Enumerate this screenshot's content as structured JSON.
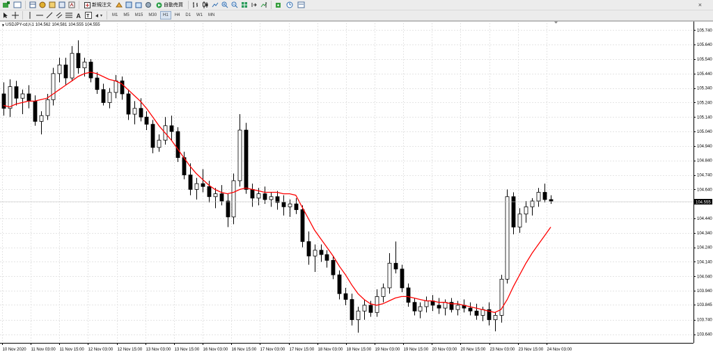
{
  "toolbar": {
    "new_order_label": "新規注文",
    "autotrade_label": "自動売買",
    "timeframes": [
      "M1",
      "M5",
      "M15",
      "M30",
      "H1",
      "H4",
      "D1",
      "W1",
      "MN"
    ],
    "active_timeframe": "H1"
  },
  "chart_header": {
    "symbol": "USDJPY-cd,H1",
    "open": "104.562",
    "high": "104.581",
    "low": "104.555",
    "close": "104.555"
  },
  "colors": {
    "moving_average": "#ff0000",
    "candle_outline": "#000000",
    "bull_candle_fill": "#ffffff",
    "bear_candle_fill": "#000000",
    "grid": "#e4e4e4",
    "price_label_bg": "#000000"
  },
  "chart_data": {
    "type": "candlestick",
    "title": "USDJPY-cd,H1",
    "ylim": [
      103.58,
      105.79
    ],
    "y_ticks": [
      103.64,
      103.74,
      103.845,
      103.94,
      104.04,
      104.14,
      104.24,
      104.34,
      104.44,
      104.555,
      104.64,
      104.74,
      104.84,
      104.94,
      105.04,
      105.14,
      105.24,
      105.34,
      105.44,
      105.54,
      105.64,
      105.74
    ],
    "y_tick_labels": [
      "103.640",
      "103.740",
      "103.845",
      "103.940",
      "104.040",
      "104.140",
      "104.240",
      "104.340",
      "104.440",
      "104.555",
      "104.640",
      "104.740",
      "104.840",
      "104.940",
      "105.040",
      "105.140",
      "105.240",
      "105.340",
      "105.440",
      "105.540",
      "105.640",
      "105.740"
    ],
    "current_price": "104.555",
    "x_labels": [
      "10 Nov 2020",
      "11 Nov 03:00",
      "11 Nov 15:00",
      "12 Nov 03:00",
      "12 Nov 15:00",
      "13 Nov 03:00",
      "13 Nov 15:00",
      "16 Nov 03:00",
      "16 Nov 15:00",
      "17 Nov 03:00",
      "17 Nov 15:00",
      "18 Nov 03:00",
      "18 Nov 15:00",
      "19 Nov 03:00",
      "19 Nov 15:00",
      "20 Nov 03:00",
      "20 Nov 15:00",
      "23 Nov 03:00",
      "23 Nov 15:00",
      "24 Nov 03:00"
    ],
    "candles": [
      [
        105.3,
        105.38,
        105.15,
        105.2
      ],
      [
        105.2,
        105.4,
        105.14,
        105.35
      ],
      [
        105.35,
        105.39,
        105.22,
        105.27
      ],
      [
        105.27,
        105.33,
        105.16,
        105.3
      ],
      [
        105.3,
        105.36,
        105.2,
        105.25
      ],
      [
        105.25,
        105.29,
        105.08,
        105.11
      ],
      [
        105.11,
        105.18,
        105.02,
        105.15
      ],
      [
        105.15,
        105.3,
        105.12,
        105.26
      ],
      [
        105.26,
        105.48,
        105.22,
        105.44
      ],
      [
        105.44,
        105.55,
        105.38,
        105.5
      ],
      [
        105.5,
        105.55,
        105.36,
        105.41
      ],
      [
        105.41,
        105.63,
        105.39,
        105.58
      ],
      [
        105.58,
        105.67,
        105.44,
        105.48
      ],
      [
        105.48,
        105.55,
        105.42,
        105.52
      ],
      [
        105.52,
        105.54,
        105.38,
        105.41
      ],
      [
        105.41,
        105.45,
        105.3,
        105.33
      ],
      [
        105.33,
        105.37,
        105.22,
        105.24
      ],
      [
        105.24,
        105.34,
        105.2,
        105.31
      ],
      [
        105.31,
        105.43,
        105.27,
        105.39
      ],
      [
        105.39,
        105.42,
        105.26,
        105.3
      ],
      [
        105.3,
        105.33,
        105.12,
        105.16
      ],
      [
        105.16,
        105.25,
        105.09,
        105.2
      ],
      [
        105.2,
        105.27,
        105.11,
        105.14
      ],
      [
        105.14,
        105.18,
        105.05,
        105.09
      ],
      [
        105.09,
        105.12,
        104.89,
        104.93
      ],
      [
        104.93,
        105.02,
        104.9,
        104.98
      ],
      [
        104.98,
        105.14,
        104.95,
        105.08
      ],
      [
        105.08,
        105.15,
        104.98,
        105.04
      ],
      [
        105.04,
        105.07,
        104.83,
        104.86
      ],
      [
        104.86,
        104.9,
        104.71,
        104.74
      ],
      [
        104.74,
        104.82,
        104.6,
        104.64
      ],
      [
        104.64,
        104.72,
        104.57,
        104.68
      ],
      [
        104.68,
        104.78,
        104.62,
        104.66
      ],
      [
        104.66,
        104.7,
        104.55,
        104.59
      ],
      [
        104.59,
        104.65,
        104.51,
        104.61
      ],
      [
        104.61,
        104.67,
        104.53,
        104.56
      ],
      [
        104.56,
        104.61,
        104.38,
        104.45
      ],
      [
        104.45,
        104.75,
        104.4,
        104.7
      ],
      [
        104.7,
        105.16,
        104.66,
        105.05
      ],
      [
        105.05,
        105.1,
        104.61,
        104.64
      ],
      [
        104.64,
        104.68,
        104.52,
        104.58
      ],
      [
        104.58,
        104.65,
        104.53,
        104.61
      ],
      [
        104.61,
        104.66,
        104.54,
        104.57
      ],
      [
        104.57,
        104.62,
        104.52,
        104.59
      ],
      [
        104.59,
        104.63,
        104.5,
        104.55
      ],
      [
        104.55,
        104.6,
        104.46,
        104.52
      ],
      [
        104.52,
        104.57,
        104.45,
        104.54
      ],
      [
        104.54,
        104.58,
        104.47,
        104.5
      ],
      [
        104.5,
        104.53,
        104.24,
        104.28
      ],
      [
        104.28,
        104.35,
        104.12,
        104.18
      ],
      [
        104.18,
        104.26,
        104.07,
        104.22
      ],
      [
        104.22,
        104.26,
        104.14,
        104.19
      ],
      [
        104.19,
        104.22,
        104.1,
        104.15
      ],
      [
        104.15,
        104.18,
        104.02,
        104.05
      ],
      [
        104.05,
        104.08,
        103.88,
        103.92
      ],
      [
        103.92,
        103.96,
        103.84,
        103.88
      ],
      [
        103.88,
        103.92,
        103.7,
        103.74
      ],
      [
        103.74,
        103.83,
        103.65,
        103.8
      ],
      [
        103.8,
        103.88,
        103.74,
        103.84
      ],
      [
        103.84,
        103.87,
        103.76,
        103.79
      ],
      [
        103.79,
        103.95,
        103.76,
        103.9
      ],
      [
        103.9,
        103.99,
        103.86,
        103.96
      ],
      [
        103.96,
        104.2,
        103.92,
        104.13
      ],
      [
        104.13,
        104.28,
        104.06,
        104.09
      ],
      [
        104.09,
        104.12,
        103.93,
        103.96
      ],
      [
        103.96,
        103.99,
        103.83,
        103.86
      ],
      [
        103.86,
        103.89,
        103.77,
        103.8
      ],
      [
        103.8,
        103.86,
        103.75,
        103.83
      ],
      [
        103.83,
        103.9,
        103.79,
        103.87
      ],
      [
        103.87,
        103.91,
        103.8,
        103.84
      ],
      [
        103.84,
        103.89,
        103.78,
        103.82
      ],
      [
        103.82,
        103.88,
        103.77,
        103.86
      ],
      [
        103.86,
        103.89,
        103.79,
        103.81
      ],
      [
        103.81,
        103.87,
        103.77,
        103.84
      ],
      [
        103.84,
        103.88,
        103.79,
        103.82
      ],
      [
        103.82,
        103.86,
        103.77,
        103.8
      ],
      [
        103.8,
        103.85,
        103.74,
        103.77
      ],
      [
        103.77,
        103.83,
        103.73,
        103.81
      ],
      [
        103.81,
        103.86,
        103.7,
        103.74
      ],
      [
        103.74,
        103.79,
        103.66,
        103.77
      ],
      [
        103.77,
        104.05,
        103.72,
        104.02
      ],
      [
        104.02,
        104.64,
        103.99,
        104.59
      ],
      [
        104.59,
        104.62,
        104.33,
        104.38
      ],
      [
        104.38,
        104.51,
        104.34,
        104.47
      ],
      [
        104.47,
        104.56,
        104.41,
        104.52
      ],
      [
        104.52,
        104.58,
        104.46,
        104.56
      ],
      [
        104.56,
        104.65,
        104.52,
        104.62
      ],
      [
        104.62,
        104.68,
        104.55,
        104.57
      ],
      [
        104.57,
        104.6,
        104.54,
        104.56
      ]
    ],
    "ma": [
      105.22,
      105.21,
      105.23,
      105.24,
      105.25,
      105.25,
      105.26,
      105.27,
      105.3,
      105.33,
      105.36,
      105.39,
      105.42,
      105.44,
      105.45,
      105.44,
      105.42,
      105.4,
      105.39,
      105.37,
      105.33,
      105.29,
      105.25,
      105.2,
      105.14,
      105.08,
      105.03,
      104.98,
      104.92,
      104.86,
      104.8,
      104.75,
      104.71,
      104.67,
      104.64,
      104.62,
      104.61,
      104.62,
      104.64,
      104.65,
      104.64,
      104.63,
      104.62,
      104.62,
      104.62,
      104.61,
      104.61,
      104.6,
      104.52,
      104.44,
      104.36,
      104.3,
      104.24,
      104.18,
      104.11,
      104.05,
      103.98,
      103.92,
      103.88,
      103.85,
      103.84,
      103.85,
      103.87,
      103.89,
      103.9,
      103.9,
      103.89,
      103.88,
      103.87,
      103.87,
      103.86,
      103.86,
      103.85,
      103.85,
      103.84,
      103.83,
      103.82,
      103.81,
      103.8,
      103.79,
      103.81,
      103.88,
      103.97,
      104.05,
      104.13,
      104.2,
      104.26,
      104.32,
      104.38
    ]
  }
}
